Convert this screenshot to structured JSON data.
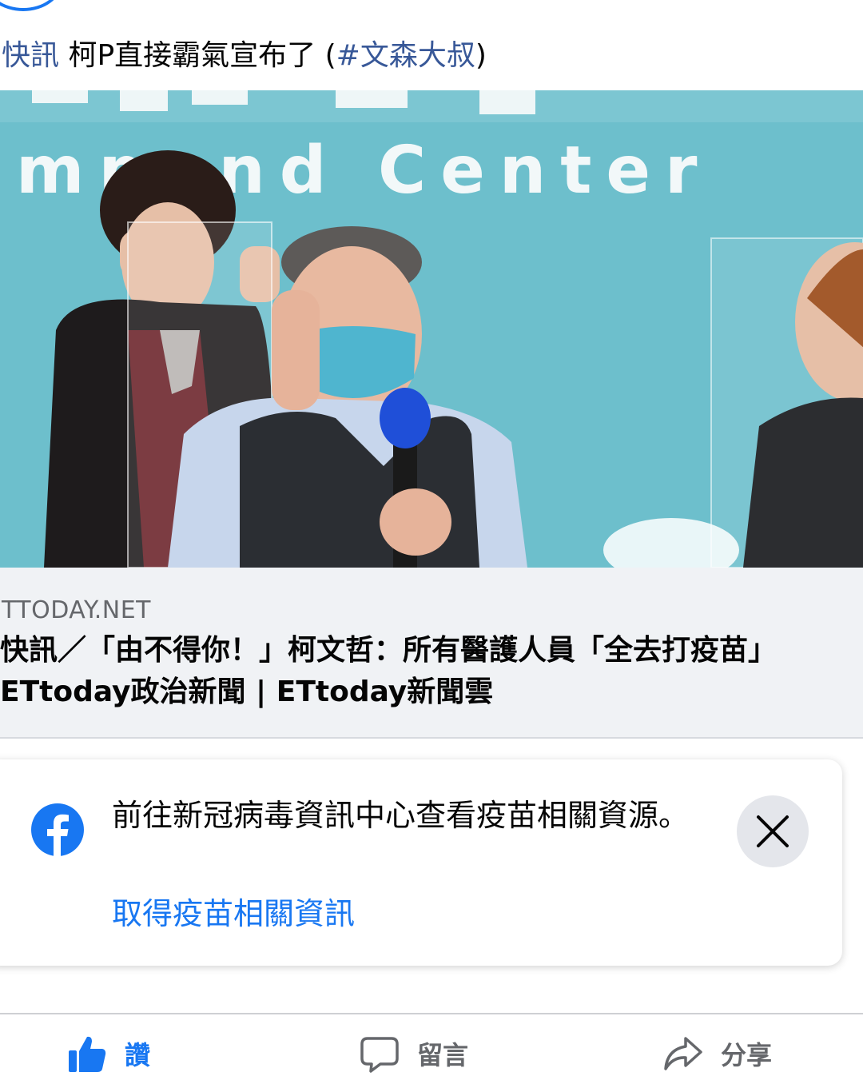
{
  "post": {
    "prefix": "快訊",
    "headline": " 柯P直接霸氣宣布了 (",
    "hashtag": "#文森大叔",
    "suffix": ")"
  },
  "photo": {
    "backdrop_text": "mm    nd  Center",
    "colors": {
      "backdrop": "#66b8c6",
      "mask": "#4fb5cf",
      "microphone": "#1f4fd8"
    }
  },
  "link_preview": {
    "domain": "TTODAY.NET",
    "title_line1": "快訊／「由不得你！」柯文哲：所有醫護人員「全去打疫苗」",
    "title_line2": " ETtoday政治新聞 | ETtoday新聞雲"
  },
  "vaccine_card": {
    "message": "前往新冠病毒資訊中心查看疫苗相關資源。",
    "link_label": "取得疫苗相關資訊",
    "accent_color": "#1877f2"
  },
  "actions": {
    "like": "讚",
    "comment": "留言",
    "share": "分享"
  }
}
